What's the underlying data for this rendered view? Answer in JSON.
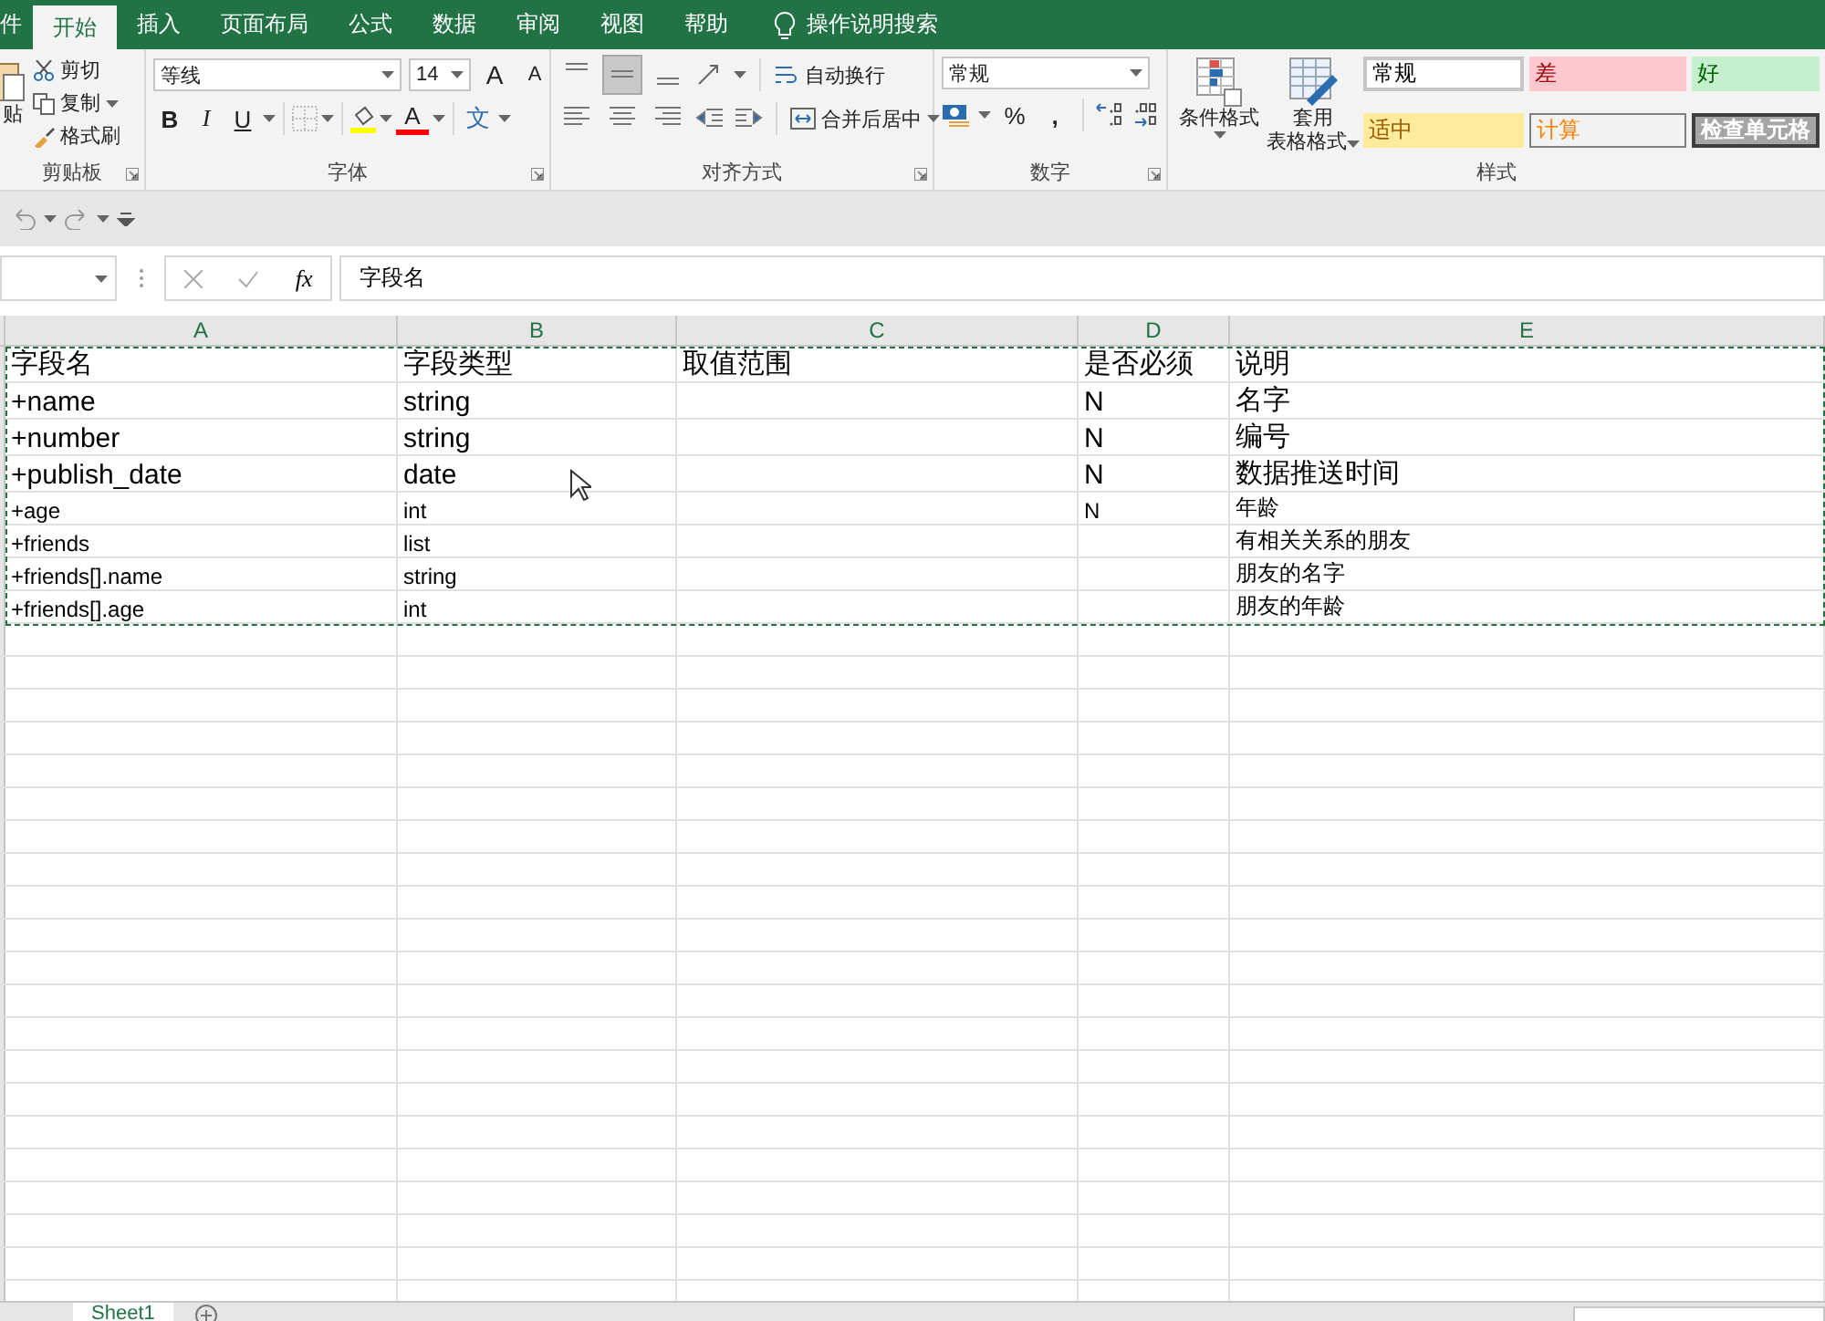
{
  "ribbon_tabs": [
    {
      "label": "件",
      "selected": false
    },
    {
      "label": "开始",
      "selected": true
    },
    {
      "label": "插入",
      "selected": false
    },
    {
      "label": "页面布局",
      "selected": false
    },
    {
      "label": "公式",
      "selected": false
    },
    {
      "label": "数据",
      "selected": false
    },
    {
      "label": "审阅",
      "selected": false
    },
    {
      "label": "视图",
      "selected": false
    },
    {
      "label": "帮助",
      "selected": false
    }
  ],
  "tell_me": "操作说明搜索",
  "clipboard": {
    "paste": "贴",
    "cut": "剪切",
    "copy": "复制",
    "format_painter": "格式刷",
    "label": "剪贴板"
  },
  "font": {
    "name": "等线",
    "size": "14",
    "grow": "A",
    "shrink": "A",
    "bold": "B",
    "italic": "I",
    "underline": "U",
    "font_color": "A",
    "phonetic": "文",
    "label": "字体"
  },
  "alignment": {
    "wrap": "自动换行",
    "merge": "合并后居中",
    "label": "对齐方式",
    "middle_align_selected": true
  },
  "number": {
    "format": "常规",
    "percent": "%",
    "comma": ",",
    "label": "数字"
  },
  "styles": {
    "conditional": "条件格式",
    "table_format": [
      "套用",
      "表格格式"
    ],
    "label": "样式",
    "cells": [
      {
        "label": "常规",
        "kind": "normal"
      },
      {
        "label": "差",
        "kind": "bad"
      },
      {
        "label": "好",
        "kind": "good"
      },
      {
        "label": "适中",
        "kind": "neutral"
      },
      {
        "label": "计算",
        "kind": "calculation"
      },
      {
        "label": "检查单元格",
        "kind": "check"
      }
    ]
  },
  "formula_bar": {
    "fx": "fx",
    "value": "字段名"
  },
  "table": {
    "columns": [
      "A",
      "B",
      "C",
      "D",
      "E"
    ],
    "copy_marquee": true,
    "rows": [
      {
        "kind": "large",
        "cells": [
          "字段名",
          "字段类型",
          "取值范围",
          "是否必须",
          "说明"
        ]
      },
      {
        "kind": "large",
        "cells": [
          "+name",
          "string",
          "",
          "N",
          "名字"
        ]
      },
      {
        "kind": "large",
        "cells": [
          "+number",
          "string",
          "",
          "N",
          "编号"
        ]
      },
      {
        "kind": "large",
        "cells": [
          "+publish_date",
          "date",
          "",
          "N",
          "数据推送时间"
        ]
      },
      {
        "kind": "small",
        "cells": [
          "+age",
          "int",
          "",
          "N",
          "年龄"
        ]
      },
      {
        "kind": "small",
        "cells": [
          "+friends",
          "list",
          "",
          "",
          "有相关关系的朋友"
        ]
      },
      {
        "kind": "small",
        "cells": [
          "+friends[].name",
          "string",
          "",
          "",
          "朋友的名字"
        ]
      },
      {
        "kind": "small",
        "cells": [
          "+friends[].age",
          "int",
          "",
          "",
          "朋友的年龄"
        ]
      }
    ]
  },
  "sheet_tabs": [
    {
      "label": "Sheet1",
      "selected": true
    }
  ]
}
